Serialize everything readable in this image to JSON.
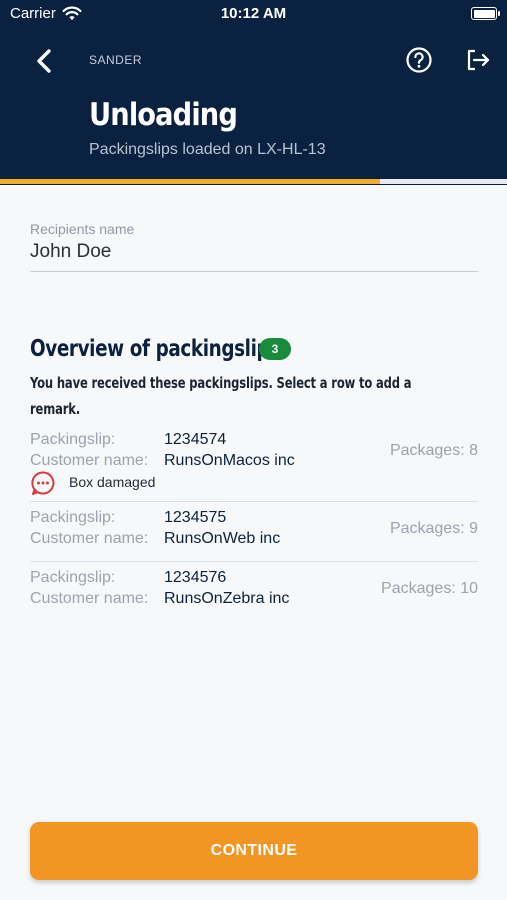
{
  "status_bar": {
    "carrier": "Carrier",
    "time": "10:12 AM",
    "wifi_icon": "wifi-icon",
    "battery_icon": "battery-icon"
  },
  "header": {
    "back_icon": "chevron-left-icon",
    "user": "SANDER",
    "help_icon": "question-circle-icon",
    "logout_icon": "logout-icon",
    "title": "Unloading",
    "subtitle": "Packingslips loaded on LX-HL-13",
    "background_color": "#0a2240"
  },
  "progress": {
    "fraction": 0.75,
    "color": "#f3ad2c"
  },
  "recipient": {
    "label": "Recipients name",
    "value": "John Doe"
  },
  "overview": {
    "title": "Overview of packingslips",
    "count": "3",
    "description": "You have received these packingslips. Select a row to add a remark."
  },
  "packingslips": [
    {
      "slip_label": "Packingslip:",
      "slip_number": "1234574",
      "customer_label": "Customer name:",
      "customer_name": "RunsOnMacos inc",
      "packages": "Packages: 8",
      "remark_icon": "chat-bubble-icon",
      "remark": "Box damaged"
    },
    {
      "slip_label": "Packingslip:",
      "slip_number": "1234575",
      "customer_label": "Customer name:",
      "customer_name": "RunsOnWeb inc",
      "packages": "Packages: 9"
    },
    {
      "slip_label": "Packingslip:",
      "slip_number": "1234576",
      "customer_label": "Customer name:",
      "customer_name": "RunsOnZebra inc",
      "packages": "Packages: 10"
    }
  ],
  "continue_button": {
    "label": "CONTINUE",
    "color": "#f39523"
  }
}
